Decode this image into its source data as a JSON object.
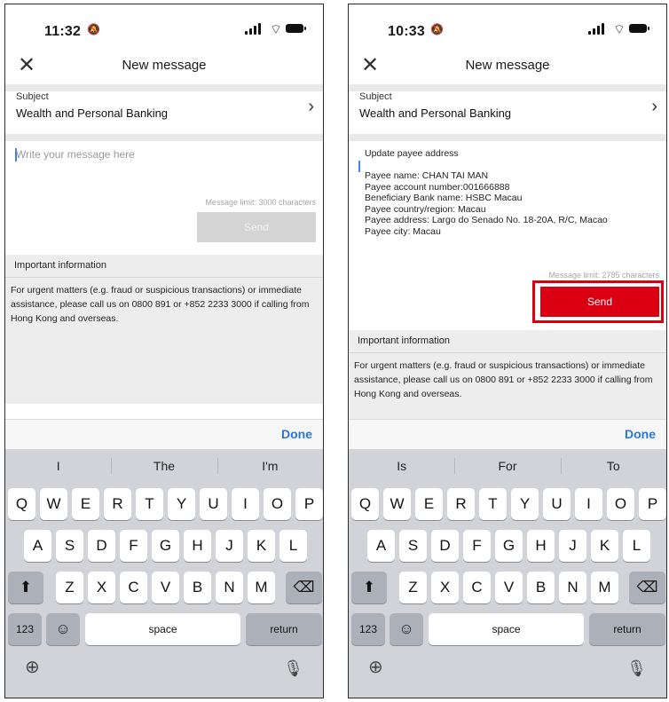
{
  "left": {
    "status": {
      "time": "11:32"
    },
    "nav": {
      "title": "New message"
    },
    "subject": {
      "label": "Subject",
      "value": "Wealth and Personal Banking"
    },
    "message": {
      "placeholder": "Write your message here",
      "limit": "Message limit: 3000 characters"
    },
    "send_label": "Send",
    "info": {
      "heading": "Important information",
      "body": "For urgent matters (e.g. fraud or suspicious transactions) or immediate assistance, please call us on 0800 891 or +852 2233 3000 if calling from Hong Kong and overseas."
    },
    "done_label": "Done",
    "suggestions": [
      "I",
      "The",
      "I'm"
    ]
  },
  "right": {
    "status": {
      "time": "10:33"
    },
    "nav": {
      "title": "New message"
    },
    "subject": {
      "label": "Subject",
      "value": "Wealth and Personal Banking"
    },
    "message": {
      "text": "Update payee address\n\nPayee name: CHAN TAI MAN\nPayee account number:001666888\nBeneficiary Bank name: HSBC Macau\nPayee country/region: Macau\nPayee address: Largo do Senado No. 18-20A, R/C, Macao\nPayee city: Macau",
      "limit": "Message limit: 2785 characters"
    },
    "send_label": "Send",
    "info": {
      "heading": "Important information",
      "body": "For urgent matters (e.g. fraud or suspicious transactions) or immediate assistance, please call us on 0800 891 or +852 2233 3000 if calling from Hong Kong and overseas."
    },
    "done_label": "Done",
    "suggestions": [
      "Is",
      "For",
      "To"
    ]
  },
  "keyboard": {
    "row1": [
      "Q",
      "W",
      "E",
      "R",
      "T",
      "Y",
      "U",
      "I",
      "O",
      "P"
    ],
    "row2": [
      "A",
      "S",
      "D",
      "F",
      "G",
      "H",
      "J",
      "K",
      "L"
    ],
    "row3": [
      "Z",
      "X",
      "C",
      "V",
      "B",
      "N",
      "M"
    ],
    "numbers": "123",
    "space": "space",
    "return": "return",
    "shift_icon": "shift-arrow-icon",
    "backspace_icon": "backspace-icon",
    "emoji_icon": "emoji-icon",
    "globe_icon": "globe-icon",
    "mic_icon": "microphone-icon"
  },
  "colors": {
    "accent": "#db0011",
    "link": "#2a78d4",
    "disabled": "#d4d4d4"
  }
}
